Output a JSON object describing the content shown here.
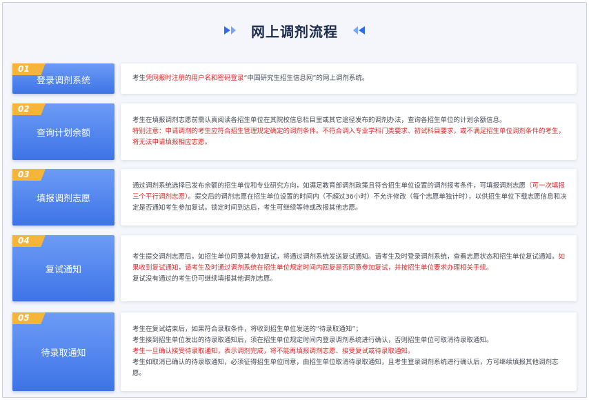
{
  "page": {
    "title": "网上调剂流程"
  },
  "steps": [
    {
      "num": "01",
      "title": "登录调剂系统",
      "lines": [
        {
          "parts": [
            {
              "text": "考生",
              "red": false
            },
            {
              "text": "凭网报时注册的用户名和密码登录",
              "red": true
            },
            {
              "text": "“中国研究生招生信息网”的网上调剂系统。",
              "red": false
            }
          ]
        }
      ]
    },
    {
      "num": "02",
      "title": "查询计划余额",
      "lines": [
        {
          "parts": [
            {
              "text": "考生在填报调剂志愿前需认真阅读各招生单位在其院校信息栏目里或其它途径发布的调剂办法，查询各招生单位的计划余额信息。",
              "red": false
            }
          ]
        },
        {
          "parts": [
            {
              "text": "特别注意：申请调剂的考生应符合招生管理规定确定的调剂条件。不符合调入专业学科门类要求、初试科目要求，或不满足招生单位调剂条件的考生，将无法申请填报相应志愿。",
              "red": true
            }
          ]
        }
      ]
    },
    {
      "num": "03",
      "title": "填报调剂志愿",
      "lines": [
        {
          "parts": [
            {
              "text": "通过调剂系统选择已发布余额的招生单位和专业研究方向，如满足教育部调剂政策且符合招生单位设置的调剂报考条件，可填报调剂志愿",
              "red": false
            },
            {
              "text": "（可一次填报三个平行调剂志愿）",
              "red": true
            },
            {
              "text": "。提交后的调剂志愿在招生单位设置的时间内（不超过36小时）不允许修改（每个志愿单独计时），以供招生单位下载志愿信息和决定是否通知考生参加复试。锁定时间到达后，考生可继续等待或改报其他志愿。",
              "red": false
            }
          ]
        }
      ]
    },
    {
      "num": "04",
      "title": "复试通知",
      "lines": [
        {
          "parts": [
            {
              "text": "考生提交调剂志愿后，如招生单位同意其参加复试，将通过调剂系统发送复试通知。请考生及时登录调剂系统，查看志愿状态和招生单位复试通知。",
              "red": false
            },
            {
              "text": "如果收到复试通知，请考生及时通过调剂系统在招生单位规定时间内回复是否同意参加复试，并按招生单位要求办理相关手续。",
              "red": true
            }
          ]
        },
        {
          "parts": [
            {
              "text": "复试没有通过的考生仍可继续填报其他调剂志愿。",
              "red": false
            }
          ]
        }
      ]
    },
    {
      "num": "05",
      "title": "待录取通知",
      "lines": [
        {
          "parts": [
            {
              "text": "考生在复试结束后，如果符合录取条件，将收到招生单位发送的“待录取通知”；",
              "red": false
            }
          ]
        },
        {
          "parts": [
            {
              "text": "考生接到招生单位发出的待录取通知后，须在招生单位规定时间内登录调剂系统进行确认，否则招生单位可取消待录取通知。",
              "red": false
            }
          ]
        },
        {
          "parts": [
            {
              "text": "考生一旦确认接受待录取通知，表示调剂完成，将不能再填报调剂志愿、接受复试或待录取通知。",
              "red": true
            }
          ]
        },
        {
          "parts": [
            {
              "text": "考生如取消已确认的待录取通知，必须征得招生单位同意，由招生单位取消待录取通知，且考生登录调剂系统进行确认后，方可继续填报其他调剂志愿。",
              "red": false
            }
          ]
        }
      ]
    }
  ]
}
